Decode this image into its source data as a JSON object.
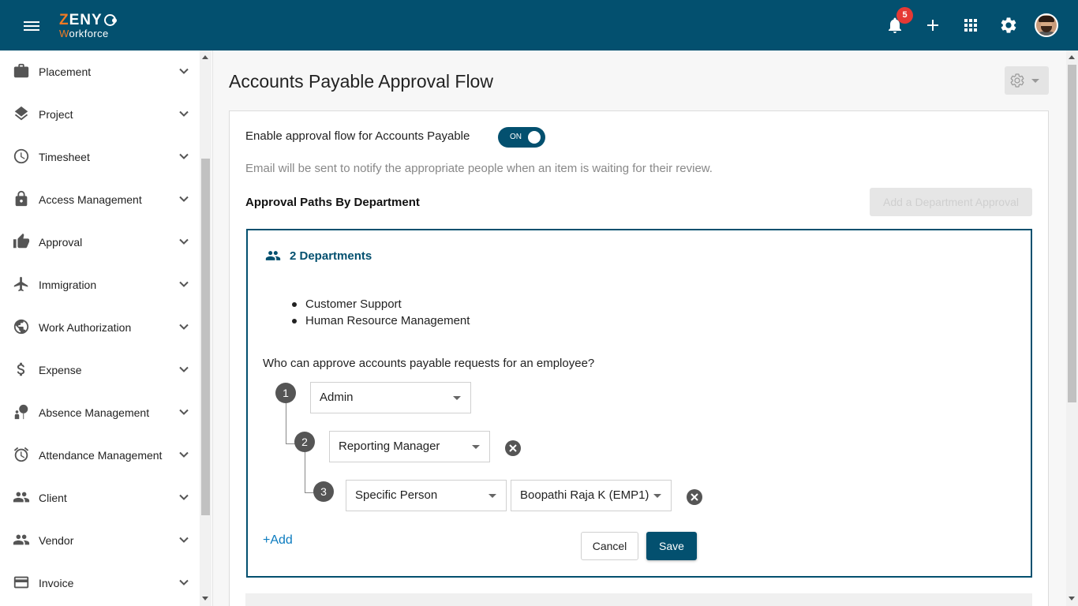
{
  "app": {
    "logo_brand": "ZENY",
    "logo_brand_first": "Z",
    "logo_sub_first": "W",
    "logo_sub_rest": "orkforce"
  },
  "topbar": {
    "notification_count": "5",
    "icons": [
      "menu-icon",
      "bell-icon",
      "plus-icon",
      "apps-grid-icon",
      "gear-icon",
      "user-avatar"
    ]
  },
  "sidebar": {
    "items": [
      {
        "label": "Placement",
        "icon": "briefcase-icon"
      },
      {
        "label": "Project",
        "icon": "layers-icon"
      },
      {
        "label": "Timesheet",
        "icon": "clock-icon"
      },
      {
        "label": "Access Management",
        "icon": "lock-icon"
      },
      {
        "label": "Approval",
        "icon": "thumbs-up-icon"
      },
      {
        "label": "Immigration",
        "icon": "airplane-icon"
      },
      {
        "label": "Work Authorization",
        "icon": "globe-person-icon"
      },
      {
        "label": "Expense",
        "icon": "dollar-icon"
      },
      {
        "label": "Absence Management",
        "icon": "person-umbrella-icon"
      },
      {
        "label": "Attendance Management",
        "icon": "alarm-icon"
      },
      {
        "label": "Client",
        "icon": "people-icon"
      },
      {
        "label": "Vendor",
        "icon": "people-icon"
      },
      {
        "label": "Invoice",
        "icon": "credit-card-icon"
      }
    ]
  },
  "main": {
    "title": "Accounts Payable Approval Flow",
    "enable_label": "Enable approval flow for Accounts Payable",
    "toggle_text": "ON",
    "email_note": "Email will be sent to notify the appropriate people when an item is waiting for their review.",
    "section_title": "Approval Paths By Department",
    "add_department_label": "Add a Department Approval",
    "department_group": {
      "count_label": "2 Departments",
      "departments": [
        "Customer Support",
        "Human Resource Management"
      ],
      "question": "Who can approve accounts payable requests for an employee?",
      "steps": [
        {
          "number": "1",
          "approver": "Admin"
        },
        {
          "number": "2",
          "approver": "Reporting Manager"
        },
        {
          "number": "3",
          "approver": "Specific Person",
          "person": "Boopathi Raja K (EMP1)"
        }
      ],
      "add_label": "+Add",
      "cancel_label": "Cancel",
      "save_label": "Save"
    }
  },
  "colors": {
    "primary": "#03506f",
    "accent_orange": "#f27a23",
    "badge_red": "#e53935",
    "link_blue": "#0b7bbf"
  }
}
